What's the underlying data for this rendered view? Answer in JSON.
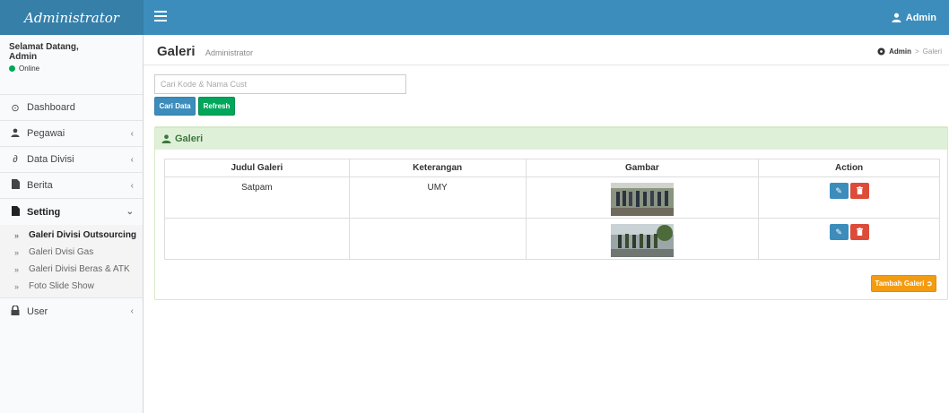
{
  "header": {
    "brand": "Administrator",
    "user_label": "Admin"
  },
  "sidebar": {
    "greeting": "Selamat Datang,",
    "user_name": "Admin",
    "status": "Online",
    "items": [
      {
        "label": "Dashboard",
        "icon": "dashboard-icon"
      },
      {
        "label": "Pegawai",
        "icon": "user-icon"
      },
      {
        "label": "Data Divisi",
        "icon": "link-icon"
      },
      {
        "label": "Berita",
        "icon": "file-icon"
      },
      {
        "label": "Setting",
        "icon": "file-icon"
      },
      {
        "label": "User",
        "icon": "lock-icon"
      }
    ],
    "setting_sub": [
      {
        "label": "Galeri Divisi Outsourcing"
      },
      {
        "label": "Galeri Dvisi Gas"
      },
      {
        "label": "Galeri Divisi Beras & ATK"
      },
      {
        "label": "Foto Slide Show"
      }
    ]
  },
  "page": {
    "title": "Galeri",
    "subtitle": "Administrator",
    "breadcrumb_home": "Admin",
    "breadcrumb_sep": ">",
    "breadcrumb_current": "Galeri"
  },
  "search": {
    "placeholder": "Cari Kode & Nama Cust",
    "value": ""
  },
  "buttons": {
    "cari": "Cari Data",
    "refresh": "Refresh",
    "tambah": "Tambah Galeri"
  },
  "box": {
    "title": "Galeri"
  },
  "table": {
    "headers": [
      "Judul Galeri",
      "Keterangan",
      "Gambar",
      "Action"
    ],
    "rows": [
      {
        "judul": "Satpam",
        "keterangan": "UMY"
      },
      {
        "judul": "",
        "keterangan": ""
      }
    ]
  },
  "colors": {
    "header": "#3c8dbc",
    "brand_bg": "#367fa9",
    "success": "#00a65a",
    "warning": "#f39c12",
    "danger": "#dd4b39",
    "box_header": "#dff0d8"
  }
}
